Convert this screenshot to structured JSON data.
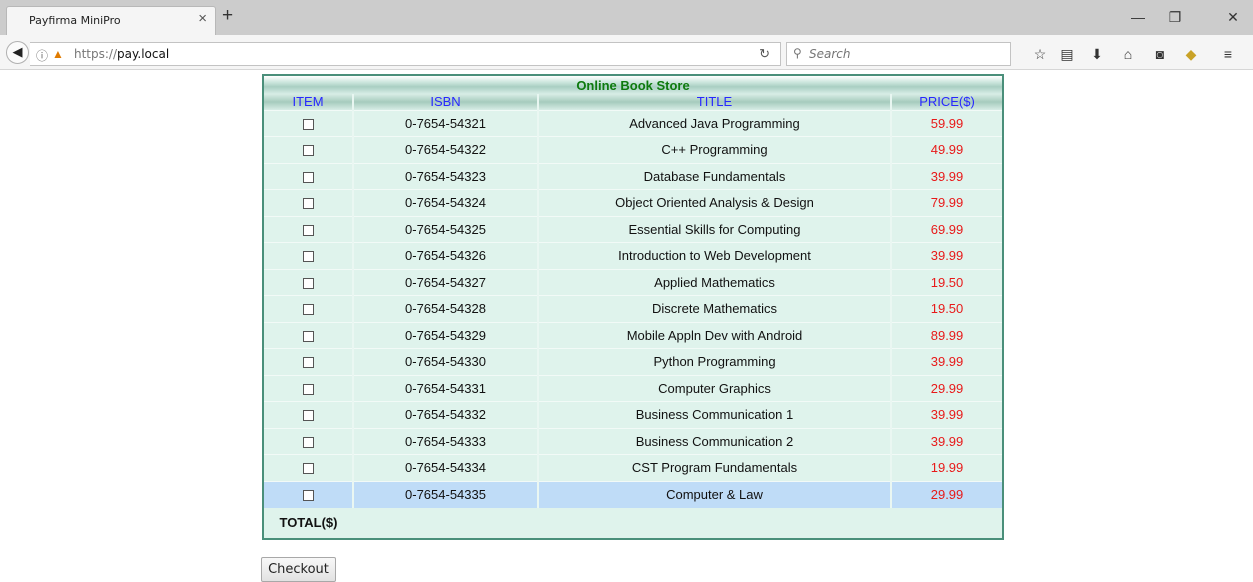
{
  "browser": {
    "tab_title": "Payfirma MiniPro",
    "url_prefix": "https://",
    "url_domain": "pay.local",
    "search_placeholder": "Search"
  },
  "store": {
    "caption": "Online Book Store",
    "columns": [
      "ITEM",
      "ISBN",
      "TITLE",
      "PRICE($)"
    ],
    "books": [
      {
        "isbn": "0-7654-54321",
        "title": "Advanced Java Programming",
        "price": "59.99"
      },
      {
        "isbn": "0-7654-54322",
        "title": "C++ Programming",
        "price": "49.99"
      },
      {
        "isbn": "0-7654-54323",
        "title": "Database Fundamentals",
        "price": "39.99"
      },
      {
        "isbn": "0-7654-54324",
        "title": "Object Oriented Analysis & Design",
        "price": "79.99"
      },
      {
        "isbn": "0-7654-54325",
        "title": "Essential Skills for Computing",
        "price": "69.99"
      },
      {
        "isbn": "0-7654-54326",
        "title": "Introduction to Web Development",
        "price": "39.99"
      },
      {
        "isbn": "0-7654-54327",
        "title": "Applied Mathematics",
        "price": "19.50"
      },
      {
        "isbn": "0-7654-54328",
        "title": "Discrete Mathematics",
        "price": "19.50"
      },
      {
        "isbn": "0-7654-54329",
        "title": "Mobile Appln Dev with Android",
        "price": "89.99"
      },
      {
        "isbn": "0-7654-54330",
        "title": "Python Programming",
        "price": "39.99"
      },
      {
        "isbn": "0-7654-54331",
        "title": "Computer Graphics",
        "price": "29.99"
      },
      {
        "isbn": "0-7654-54332",
        "title": "Business Communication 1",
        "price": "39.99"
      },
      {
        "isbn": "0-7654-54333",
        "title": "Business Communication 2",
        "price": "39.99"
      },
      {
        "isbn": "0-7654-54334",
        "title": "CST Program Fundamentals",
        "price": "19.99"
      },
      {
        "isbn": "0-7654-54335",
        "title": "Computer & Law",
        "price": "29.99",
        "highlighted": true
      }
    ],
    "total_label": "TOTAL($)",
    "checkout_label": "Checkout"
  },
  "colors": {
    "accent_green": "#0e7a0e",
    "header_blue": "#2727ff",
    "price_red": "#e81919",
    "row_highlight": "#bfdcf7",
    "table_bg": "#dff3ec"
  }
}
